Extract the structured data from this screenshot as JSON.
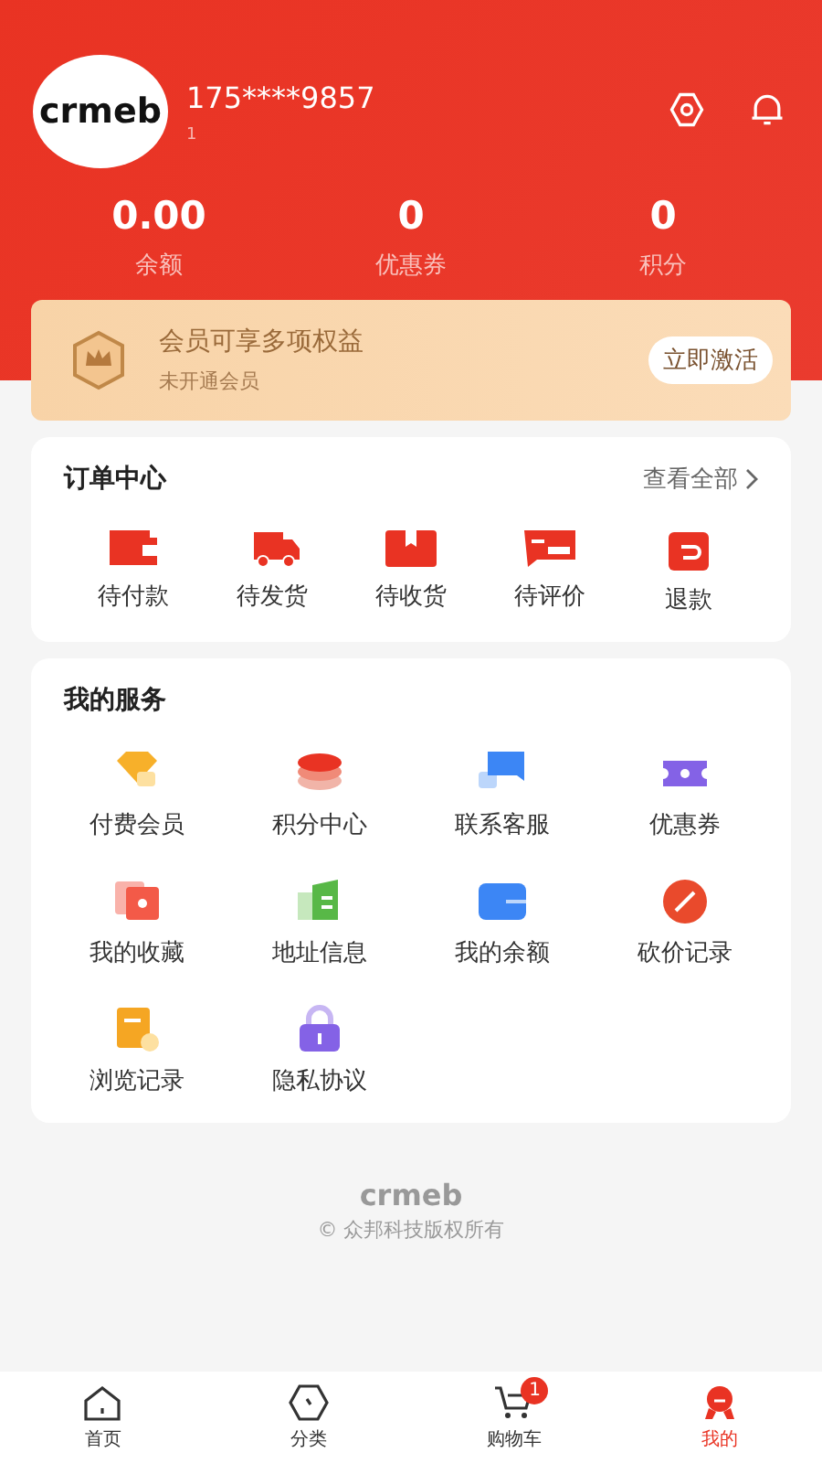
{
  "profile": {
    "avatar_logo": "crmeb",
    "phone": "175****9857",
    "sub": "1"
  },
  "stats": [
    {
      "value": "0.00",
      "label": "余额"
    },
    {
      "value": "0",
      "label": "优惠券"
    },
    {
      "value": "0",
      "label": "积分"
    }
  ],
  "membership": {
    "title": "会员可享多项权益",
    "subtitle": "未开通会员",
    "button": "立即激活"
  },
  "orders": {
    "title": "订单中心",
    "link": "查看全部",
    "items": [
      "待付款",
      "待发货",
      "待收货",
      "待评价",
      "退款"
    ]
  },
  "services": {
    "title": "我的服务",
    "items": [
      "付费会员",
      "积分中心",
      "联系客服",
      "优惠券",
      "我的收藏",
      "地址信息",
      "我的余额",
      "砍价记录",
      "浏览记录",
      "隐私协议"
    ]
  },
  "footer": {
    "logo": "crmeb",
    "copyright": "© 众邦科技版权所有"
  },
  "tabbar": [
    {
      "label": "首页",
      "selected": false
    },
    {
      "label": "分类",
      "selected": false
    },
    {
      "label": "购物车",
      "selected": false,
      "badge": "1"
    },
    {
      "label": "我的",
      "selected": true
    }
  ]
}
